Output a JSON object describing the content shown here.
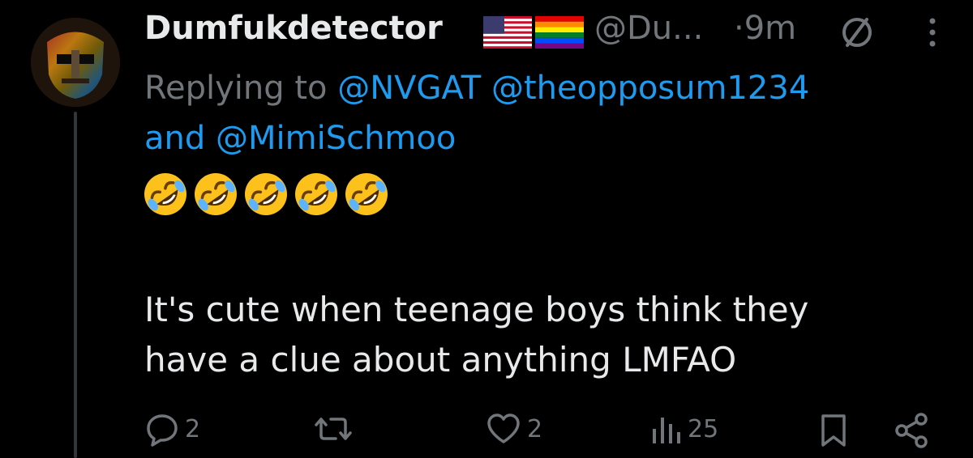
{
  "tweet": {
    "display_name": "Dumfukdetector",
    "handle": "@Du...",
    "time": "·9m",
    "reply_prefix": "Replying to",
    "mentions": [
      "@NVGAT",
      "@theopposum1234",
      "and",
      "@MimiSchmoo"
    ],
    "emoji_count": 5,
    "body_line1": "It's cute when teenage boys think they",
    "body_line2": "have a clue about anything LMFAO"
  },
  "actions": {
    "reply_count": "2",
    "retweet_count": "",
    "like_count": "2",
    "views_count": "25"
  },
  "colors": {
    "background": "#000000",
    "text_primary": "#e7e9ea",
    "text_secondary": "#71767b",
    "link": "#1d9bf0"
  }
}
